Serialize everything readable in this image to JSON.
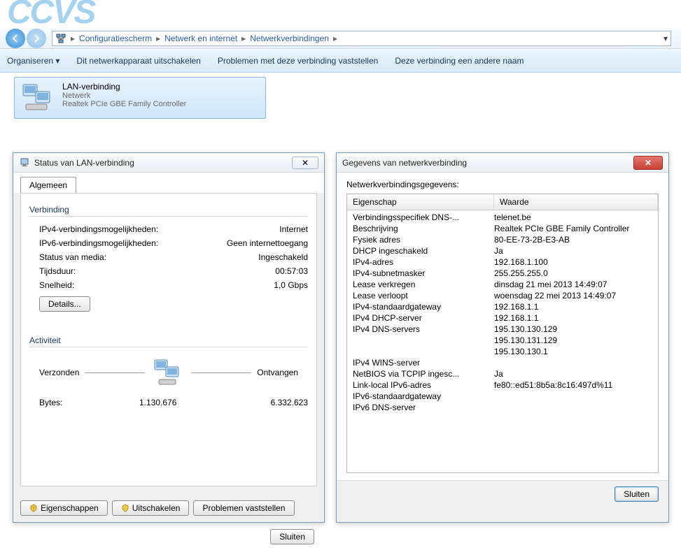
{
  "logo": "CCVS",
  "breadcrumbs": {
    "a": "Configuratiescherm",
    "b": "Netwerk en internet",
    "c": "Netwerkverbindingen"
  },
  "toolbar": {
    "organize": "Organiseren",
    "disable": "Dit netwerkapparaat uitschakelen",
    "diagnose": "Problemen met deze verbinding vaststellen",
    "rename": "Deze verbinding een andere naam"
  },
  "conn": {
    "name": "LAN-verbinding",
    "net": "Netwerk",
    "dev": "Realtek PCIe GBE Family Controller"
  },
  "status": {
    "title": "Status van LAN-verbinding",
    "tab": "Algemeen",
    "grp_conn": "Verbinding",
    "ipv4_label": "IPv4-verbindingsmogelijkheden:",
    "ipv4_val": "Internet",
    "ipv6_label": "IPv6-verbindingsmogelijkheden:",
    "ipv6_val": "Geen internettoegang",
    "media_label": "Status van media:",
    "media_val": "Ingeschakeld",
    "dur_label": "Tijdsduur:",
    "dur_val": "00:57:03",
    "speed_label": "Snelheid:",
    "speed_val": "1,0 Gbps",
    "details_btn": "Details...",
    "grp_act": "Activiteit",
    "sent": "Verzonden",
    "recv": "Ontvangen",
    "bytes_label": "Bytes:",
    "bytes_sent": "1.130.676",
    "bytes_recv": "6.332.623",
    "prop_btn": "Eigenschappen",
    "dis_btn": "Uitschakelen",
    "diag_btn": "Problemen vaststellen",
    "close_btn": "Sluiten"
  },
  "details": {
    "title": "Gegevens van netwerkverbinding",
    "label": "Netwerkverbindingsgegevens:",
    "col1": "Eigenschap",
    "col2": "Waarde",
    "rows": [
      {
        "k": "Verbindingsspecifiek DNS-...",
        "v": "telenet.be"
      },
      {
        "k": "Beschrijving",
        "v": "Realtek PCIe GBE Family Controller"
      },
      {
        "k": "Fysiek adres",
        "v": "80-EE-73-2B-E3-AB"
      },
      {
        "k": "DHCP ingeschakeld",
        "v": "Ja"
      },
      {
        "k": "IPv4-adres",
        "v": "192.168.1.100"
      },
      {
        "k": "IPv4-subnetmasker",
        "v": "255.255.255.0"
      },
      {
        "k": "Lease verkregen",
        "v": "dinsdag 21 mei 2013 14:49:07"
      },
      {
        "k": "Lease verloopt",
        "v": "woensdag 22 mei 2013 14:49:07"
      },
      {
        "k": "IPv4-standaardgateway",
        "v": "192.168.1.1"
      },
      {
        "k": "IPv4 DHCP-server",
        "v": "192.168.1.1"
      },
      {
        "k": "IPv4 DNS-servers",
        "v": "195.130.130.129"
      },
      {
        "k": "",
        "v": "195.130.131.129"
      },
      {
        "k": "",
        "v": "195.130.130.1"
      },
      {
        "k": "IPv4 WINS-server",
        "v": ""
      },
      {
        "k": "NetBIOS via TCPIP ingesc...",
        "v": "Ja"
      },
      {
        "k": "Link-local IPv6-adres",
        "v": "fe80::ed51:8b5a:8c16:497d%11"
      },
      {
        "k": "IPv6-standaardgateway",
        "v": ""
      },
      {
        "k": "IPv6 DNS-server",
        "v": ""
      }
    ],
    "close_btn": "Sluiten"
  }
}
